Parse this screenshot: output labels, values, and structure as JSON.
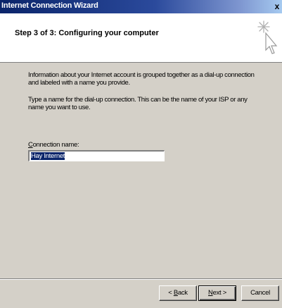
{
  "window": {
    "title": "Internet Connection Wizard",
    "close_label": "x"
  },
  "header": {
    "step_title": "Step 3 of 3: Configuring your computer",
    "icon": "wizard-wand-cursor-icon"
  },
  "content": {
    "paragraph1": "Information about your Internet account is grouped together as a dial-up connection and labeled with a name you provide.",
    "paragraph2": "Type a name for the dial-up connection. This can be the name of your ISP or any name you want to use.",
    "connection_name_label_accel": "C",
    "connection_name_label_rest": "onnection name:",
    "connection_name_value": "Hay Internet"
  },
  "buttons": {
    "back_prefix": "< ",
    "back_accel": "B",
    "back_rest": "ack",
    "next_accel": "N",
    "next_rest": "ext >",
    "cancel": "Cancel"
  },
  "colors": {
    "titlebar": "#0a246a",
    "face": "#d4d0c8",
    "selection": "#0a246a"
  }
}
